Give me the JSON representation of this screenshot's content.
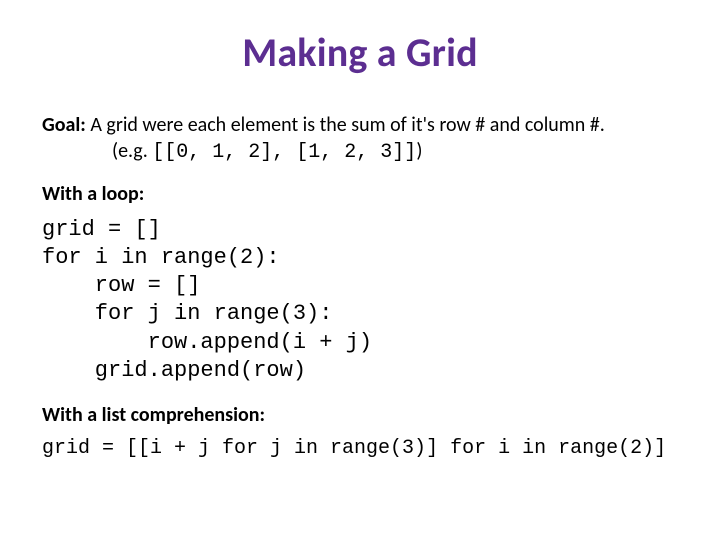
{
  "title": "Making a Grid",
  "goal": {
    "label": "Goal:",
    "text": " A grid were each element is the sum of it's row # and column #."
  },
  "example": {
    "prefix": "(e.g. ",
    "code": "[[0, 1, 2], [1, 2, 3]]",
    "suffix": ")"
  },
  "section_loop": "With a loop:",
  "code_loop": "grid = []\nfor i in range(2):\n    row = []\n    for j in range(3):\n        row.append(i + j)\n    grid.append(row)",
  "section_comp": "With a list comprehension:",
  "code_comp": "grid = [[i + j for j in range(3)] for i in range(2)]"
}
